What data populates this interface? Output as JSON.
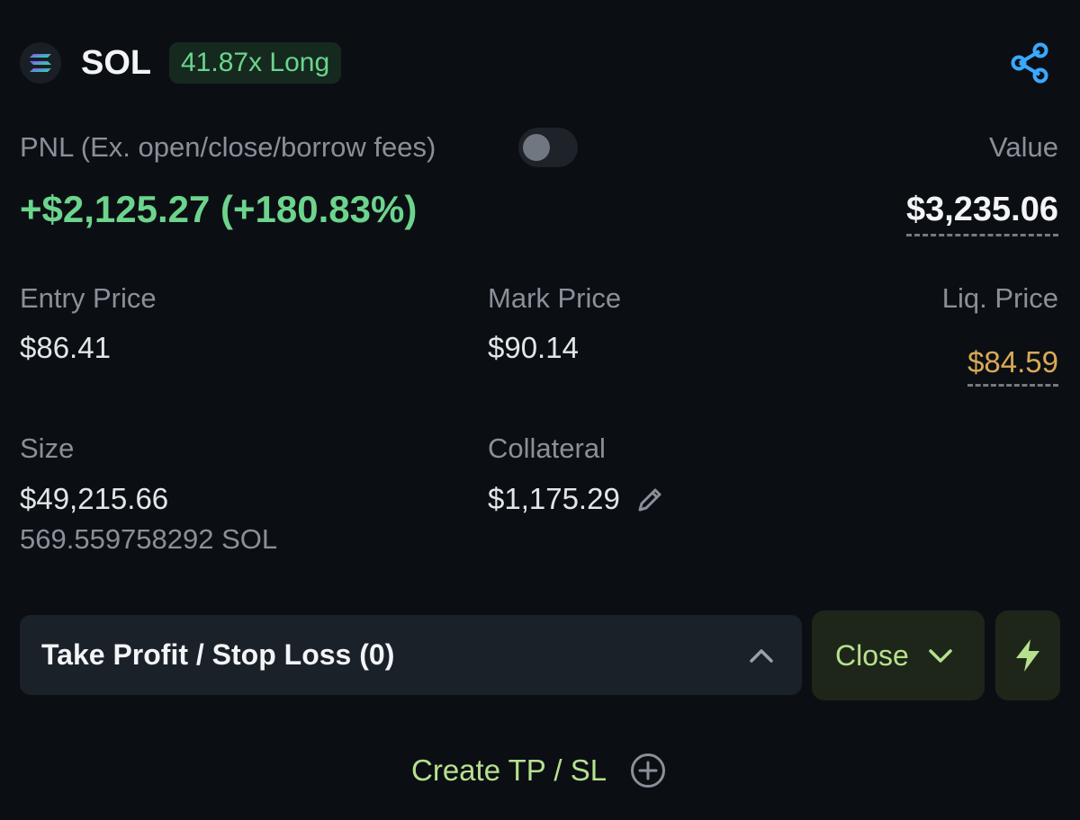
{
  "position": {
    "symbol": "SOL",
    "logo_icon": "solana-logo-icon",
    "leverage_badge": "41.87x Long",
    "share_icon": "share-icon"
  },
  "pnl": {
    "label": "PNL (Ex. open/close/borrow fees)",
    "value": "+$2,125.27 (+180.83%)",
    "toggle_on": false
  },
  "value": {
    "label": "Value",
    "amount": "$3,235.06"
  },
  "stats": {
    "entry_price": {
      "label": "Entry Price",
      "value": "$86.41"
    },
    "mark_price": {
      "label": "Mark Price",
      "value": "$90.14"
    },
    "liq_price": {
      "label": "Liq. Price",
      "value": "$84.59"
    },
    "size": {
      "label": "Size",
      "value": "$49,215.66",
      "sub": "569.559758292 SOL"
    },
    "collateral": {
      "label": "Collateral",
      "value": "$1,175.29",
      "edit_icon": "pencil-icon"
    }
  },
  "actions": {
    "tpsl_title": "Take Profit / Stop Loss (0)",
    "close_label": "Close",
    "flash_icon": "lightning-icon",
    "create_tpsl": "Create TP / SL",
    "create_icon": "plus-circle-icon"
  },
  "colors": {
    "background": "#0b0f14",
    "positive": "#6cd48c",
    "liquidation": "#d9a957",
    "accent_link": "#b7e08e",
    "share_blue": "#3aa8ff"
  }
}
